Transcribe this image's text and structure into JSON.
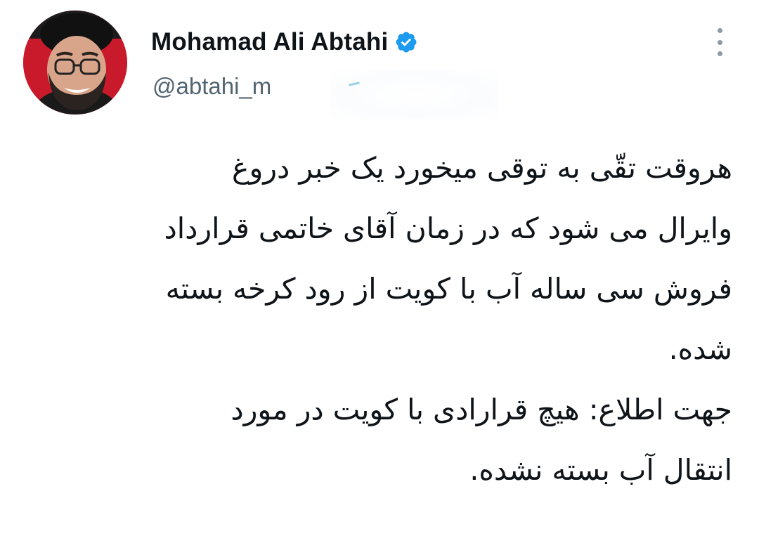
{
  "author": {
    "name": "Mohamad Ali Abtahi",
    "handle": "@abtahi_m",
    "verified": true
  },
  "icons": {
    "verified": "verified-badge-icon",
    "more": "more-vertical-icon"
  },
  "colors": {
    "verified_blue": "#1d9bf0",
    "handle_gray": "#536471",
    "text": "#0f1419",
    "avatar_background": "#c81a2a"
  },
  "tweet": {
    "lines": [
      "هروقت تقّی به توقی میخورد یک خبر دروغ",
      "وایرال می شود که در زمان آقای خاتمی قرارداد",
      "فروش سی ساله آب با کویت از رود کرخه بسته",
      "شده.",
      "جهت اطلاع: هیچ قرارادی با کویت در مورد",
      "انتقال آب بسته نشده."
    ]
  }
}
